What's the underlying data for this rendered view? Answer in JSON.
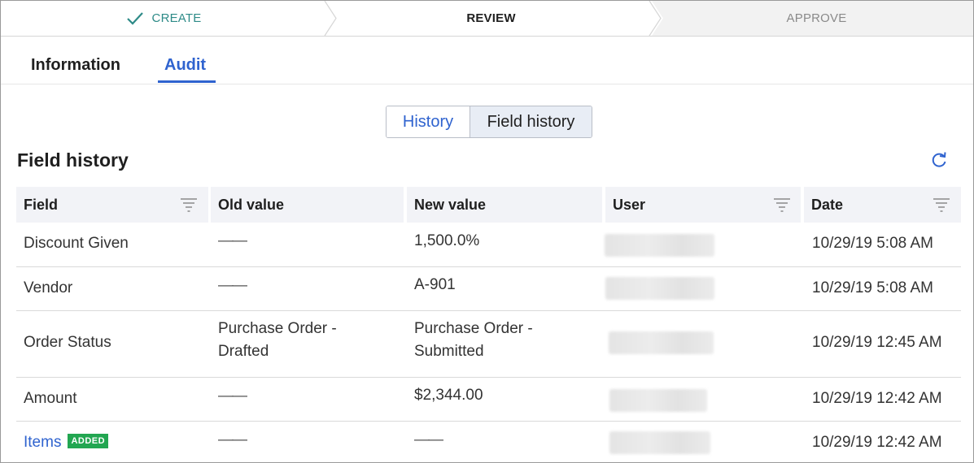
{
  "stepper": {
    "steps": [
      {
        "label": "CREATE",
        "state": "completed"
      },
      {
        "label": "REVIEW",
        "state": "current"
      },
      {
        "label": "APPROVE",
        "state": "upcoming"
      }
    ]
  },
  "tabs": [
    {
      "label": "Information",
      "active": false
    },
    {
      "label": "Audit",
      "active": true
    }
  ],
  "segmented": {
    "options": [
      "History",
      "Field history"
    ],
    "selected": "Field history"
  },
  "section": {
    "title": "Field history",
    "refresh_icon": "refresh-icon"
  },
  "table": {
    "columns": [
      "Field",
      "Old value",
      "New value",
      "User",
      "Date"
    ],
    "rows": [
      {
        "field": "Discount Given",
        "old": "——",
        "new": "1,500.0%",
        "user": "",
        "date": "10/29/19 5:08 AM"
      },
      {
        "field": "Vendor",
        "old": "——",
        "new": "A-901",
        "user": "",
        "date": "10/29/19 5:08 AM"
      },
      {
        "field": "Order Status",
        "old_lines": [
          "Purchase Order -",
          "Drafted"
        ],
        "new_lines": [
          "Purchase Order -",
          "Submitted"
        ],
        "user": "",
        "date": "10/29/19 12:45 AM"
      },
      {
        "field": "Amount",
        "old": "——",
        "new": "$2,344.00",
        "user": "",
        "date": "10/29/19 12:42 AM"
      },
      {
        "field": "Items",
        "badge": "ADDED",
        "old": "——",
        "new": "——",
        "user": "",
        "date": "10/29/19 12:42 AM"
      }
    ]
  },
  "colors": {
    "accent": "#2f63cf",
    "completed": "#2e8b88",
    "badge": "#22a651"
  }
}
